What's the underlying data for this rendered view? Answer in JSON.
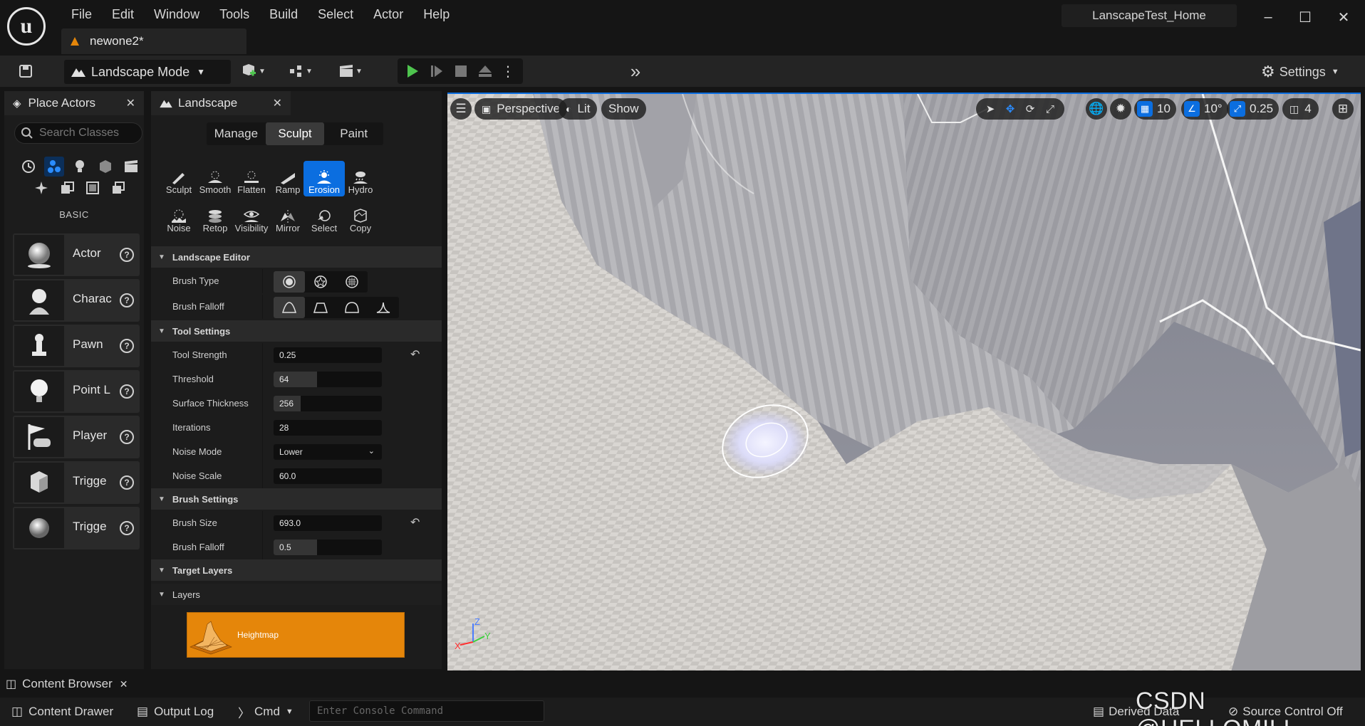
{
  "app": {
    "menu": [
      "File",
      "Edit",
      "Window",
      "Tools",
      "Build",
      "Select",
      "Actor",
      "Help"
    ],
    "document_tab": "newone2*",
    "project_name": "LanscapeTest_Home"
  },
  "toolbar": {
    "mode": "Landscape Mode",
    "settings_label": "Settings"
  },
  "place_actors": {
    "title": "Place Actors",
    "search_placeholder": "Search Classes",
    "category_label": "BASIC",
    "items": [
      "Actor",
      "Charac",
      "Pawn",
      "Point L",
      "Player",
      "Trigge",
      "Trigge"
    ]
  },
  "landscape": {
    "title": "Landscape",
    "modes": [
      "Manage",
      "Sculpt",
      "Paint"
    ],
    "active_mode": "Sculpt",
    "tools": [
      {
        "label": "Sculpt",
        "icon": "sculpt-icon"
      },
      {
        "label": "Smooth",
        "icon": "smooth-icon"
      },
      {
        "label": "Flatten",
        "icon": "flatten-icon"
      },
      {
        "label": "Ramp",
        "icon": "ramp-icon"
      },
      {
        "label": "Erosion",
        "icon": "erosion-icon"
      },
      {
        "label": "Hydro",
        "icon": "hydro-icon"
      },
      {
        "label": "Noise",
        "icon": "noise-icon"
      },
      {
        "label": "Retop",
        "icon": "retop-icon"
      },
      {
        "label": "Visibility",
        "icon": "visibility-icon"
      },
      {
        "label": "Mirror",
        "icon": "mirror-icon"
      },
      {
        "label": "Select",
        "icon": "select-icon"
      },
      {
        "label": "Copy",
        "icon": "copy-icon"
      }
    ],
    "active_tool": "Erosion",
    "sections": {
      "editor": "Landscape Editor",
      "tool_settings": "Tool Settings",
      "brush_settings": "Brush Settings",
      "target_layers": "Target Layers",
      "layers": "Layers"
    },
    "brush_type_label": "Brush Type",
    "brush_falloff_type_label": "Brush Falloff",
    "tool_strength": {
      "label": "Tool Strength",
      "value": "0.25",
      "fraction": 0.0
    },
    "threshold": {
      "label": "Threshold",
      "value": "64",
      "fraction": 0.4
    },
    "surface_thickness": {
      "label": "Surface Thickness",
      "value": "256",
      "fraction": 0.25
    },
    "iterations": {
      "label": "Iterations",
      "value": "28",
      "fraction": 0.0
    },
    "noise_mode": {
      "label": "Noise Mode",
      "value": "Lower"
    },
    "noise_scale": {
      "label": "Noise Scale",
      "value": "60.0",
      "fraction": 0.0
    },
    "brush_size": {
      "label": "Brush Size",
      "value": "693.0",
      "fraction": 0.0
    },
    "brush_falloff": {
      "label": "Brush Falloff",
      "value": "0.5",
      "fraction": 0.4
    },
    "layer_name": "Heightmap"
  },
  "viewport": {
    "view": "Perspective",
    "lighting": "Lit",
    "show": "Show",
    "grid_snap": "10",
    "rotation_snap": "10°",
    "scale_snap": "0.25",
    "camera_speed": "4"
  },
  "bottom": {
    "content_browser_tab": "Content Browser",
    "content_drawer": "Content Drawer",
    "output_log": "Output Log",
    "cmd": "Cmd",
    "console_placeholder": "Enter Console Command",
    "derived_data": "Derived Data",
    "source_control": "Source Control Off",
    "watermark": "CSDN @HELLOMILI"
  }
}
